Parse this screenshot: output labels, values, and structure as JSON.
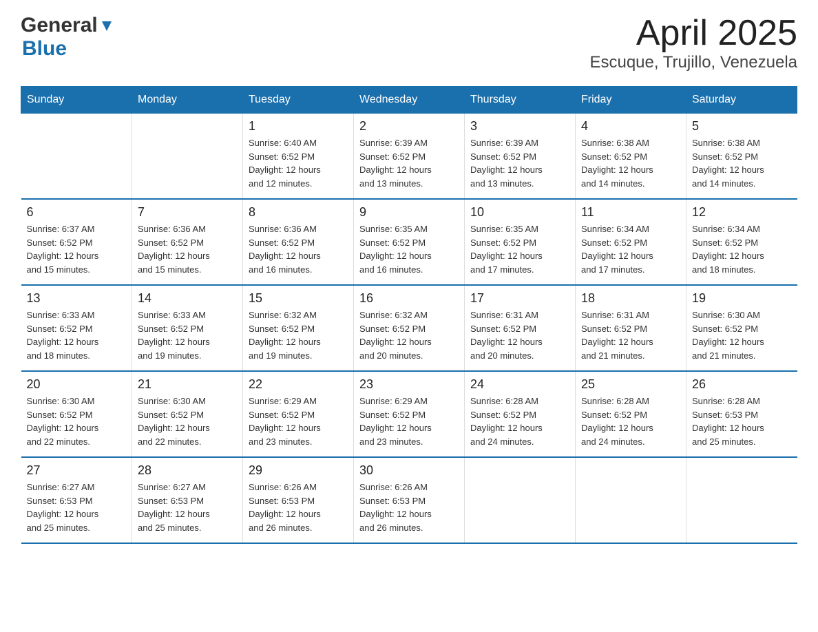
{
  "header": {
    "logo_general": "General",
    "logo_blue": "Blue",
    "month_title": "April 2025",
    "location": "Escuque, Trujillo, Venezuela"
  },
  "days_of_week": [
    "Sunday",
    "Monday",
    "Tuesday",
    "Wednesday",
    "Thursday",
    "Friday",
    "Saturday"
  ],
  "weeks": [
    {
      "days": [
        {
          "number": "",
          "info": ""
        },
        {
          "number": "",
          "info": ""
        },
        {
          "number": "1",
          "info": "Sunrise: 6:40 AM\nSunset: 6:52 PM\nDaylight: 12 hours\nand 12 minutes."
        },
        {
          "number": "2",
          "info": "Sunrise: 6:39 AM\nSunset: 6:52 PM\nDaylight: 12 hours\nand 13 minutes."
        },
        {
          "number": "3",
          "info": "Sunrise: 6:39 AM\nSunset: 6:52 PM\nDaylight: 12 hours\nand 13 minutes."
        },
        {
          "number": "4",
          "info": "Sunrise: 6:38 AM\nSunset: 6:52 PM\nDaylight: 12 hours\nand 14 minutes."
        },
        {
          "number": "5",
          "info": "Sunrise: 6:38 AM\nSunset: 6:52 PM\nDaylight: 12 hours\nand 14 minutes."
        }
      ]
    },
    {
      "days": [
        {
          "number": "6",
          "info": "Sunrise: 6:37 AM\nSunset: 6:52 PM\nDaylight: 12 hours\nand 15 minutes."
        },
        {
          "number": "7",
          "info": "Sunrise: 6:36 AM\nSunset: 6:52 PM\nDaylight: 12 hours\nand 15 minutes."
        },
        {
          "number": "8",
          "info": "Sunrise: 6:36 AM\nSunset: 6:52 PM\nDaylight: 12 hours\nand 16 minutes."
        },
        {
          "number": "9",
          "info": "Sunrise: 6:35 AM\nSunset: 6:52 PM\nDaylight: 12 hours\nand 16 minutes."
        },
        {
          "number": "10",
          "info": "Sunrise: 6:35 AM\nSunset: 6:52 PM\nDaylight: 12 hours\nand 17 minutes."
        },
        {
          "number": "11",
          "info": "Sunrise: 6:34 AM\nSunset: 6:52 PM\nDaylight: 12 hours\nand 17 minutes."
        },
        {
          "number": "12",
          "info": "Sunrise: 6:34 AM\nSunset: 6:52 PM\nDaylight: 12 hours\nand 18 minutes."
        }
      ]
    },
    {
      "days": [
        {
          "number": "13",
          "info": "Sunrise: 6:33 AM\nSunset: 6:52 PM\nDaylight: 12 hours\nand 18 minutes."
        },
        {
          "number": "14",
          "info": "Sunrise: 6:33 AM\nSunset: 6:52 PM\nDaylight: 12 hours\nand 19 minutes."
        },
        {
          "number": "15",
          "info": "Sunrise: 6:32 AM\nSunset: 6:52 PM\nDaylight: 12 hours\nand 19 minutes."
        },
        {
          "number": "16",
          "info": "Sunrise: 6:32 AM\nSunset: 6:52 PM\nDaylight: 12 hours\nand 20 minutes."
        },
        {
          "number": "17",
          "info": "Sunrise: 6:31 AM\nSunset: 6:52 PM\nDaylight: 12 hours\nand 20 minutes."
        },
        {
          "number": "18",
          "info": "Sunrise: 6:31 AM\nSunset: 6:52 PM\nDaylight: 12 hours\nand 21 minutes."
        },
        {
          "number": "19",
          "info": "Sunrise: 6:30 AM\nSunset: 6:52 PM\nDaylight: 12 hours\nand 21 minutes."
        }
      ]
    },
    {
      "days": [
        {
          "number": "20",
          "info": "Sunrise: 6:30 AM\nSunset: 6:52 PM\nDaylight: 12 hours\nand 22 minutes."
        },
        {
          "number": "21",
          "info": "Sunrise: 6:30 AM\nSunset: 6:52 PM\nDaylight: 12 hours\nand 22 minutes."
        },
        {
          "number": "22",
          "info": "Sunrise: 6:29 AM\nSunset: 6:52 PM\nDaylight: 12 hours\nand 23 minutes."
        },
        {
          "number": "23",
          "info": "Sunrise: 6:29 AM\nSunset: 6:52 PM\nDaylight: 12 hours\nand 23 minutes."
        },
        {
          "number": "24",
          "info": "Sunrise: 6:28 AM\nSunset: 6:52 PM\nDaylight: 12 hours\nand 24 minutes."
        },
        {
          "number": "25",
          "info": "Sunrise: 6:28 AM\nSunset: 6:52 PM\nDaylight: 12 hours\nand 24 minutes."
        },
        {
          "number": "26",
          "info": "Sunrise: 6:28 AM\nSunset: 6:53 PM\nDaylight: 12 hours\nand 25 minutes."
        }
      ]
    },
    {
      "days": [
        {
          "number": "27",
          "info": "Sunrise: 6:27 AM\nSunset: 6:53 PM\nDaylight: 12 hours\nand 25 minutes."
        },
        {
          "number": "28",
          "info": "Sunrise: 6:27 AM\nSunset: 6:53 PM\nDaylight: 12 hours\nand 25 minutes."
        },
        {
          "number": "29",
          "info": "Sunrise: 6:26 AM\nSunset: 6:53 PM\nDaylight: 12 hours\nand 26 minutes."
        },
        {
          "number": "30",
          "info": "Sunrise: 6:26 AM\nSunset: 6:53 PM\nDaylight: 12 hours\nand 26 minutes."
        },
        {
          "number": "",
          "info": ""
        },
        {
          "number": "",
          "info": ""
        },
        {
          "number": "",
          "info": ""
        }
      ]
    }
  ]
}
